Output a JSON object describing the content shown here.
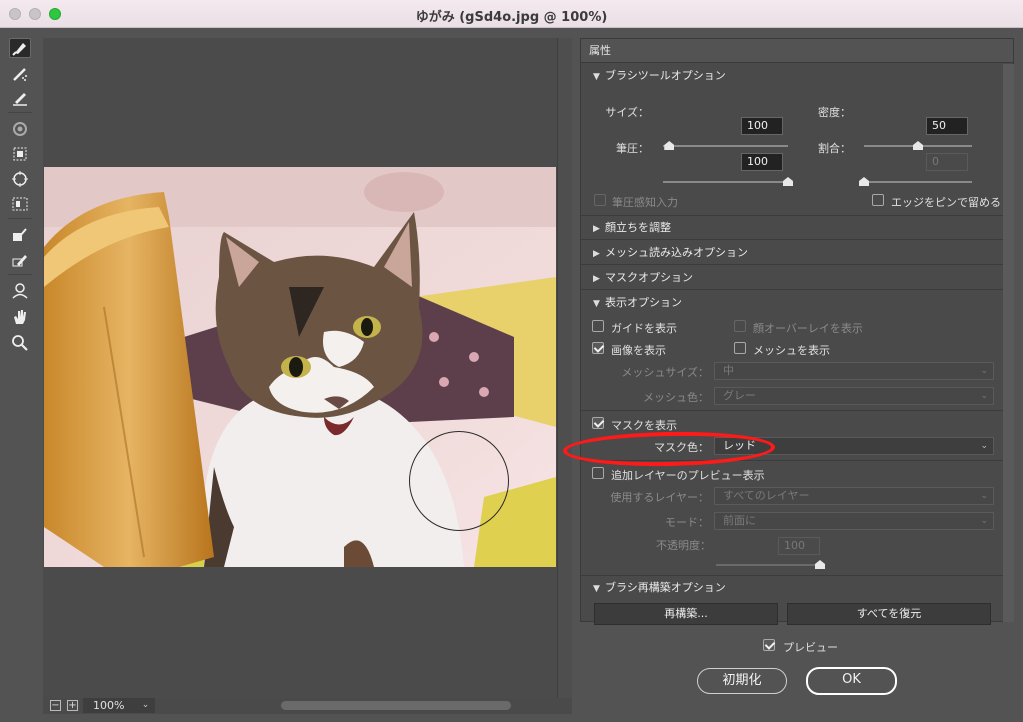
{
  "window": {
    "title": "ゆがみ (gSd4o.jpg @ 100%)"
  },
  "toolbar": {
    "tools": [
      "forward-warp-tool",
      "reconstruct-tool",
      "smooth-tool",
      "twirl-clockwise-tool",
      "pucker-tool",
      "bloat-tool",
      "push-left-tool",
      "freeze-mask-tool",
      "thaw-mask-tool",
      "face-tool",
      "hand-tool",
      "zoom-tool"
    ]
  },
  "canvas": {
    "zoom": "100%",
    "zoom_out": "−",
    "zoom_in": "+"
  },
  "panel": {
    "title": "属性",
    "brush": {
      "header": "ブラシツールオプション",
      "size_label": "サイズ：",
      "size_value": "100",
      "size_fraction": 0.05,
      "density_label": "密度：",
      "density_value": "50",
      "density_fraction": 0.5,
      "pressure_label": "筆圧：",
      "pressure_value": "100",
      "pressure_fraction": 1.0,
      "rate_label": "割合：",
      "rate_value": "0",
      "rate_fraction": 0.0,
      "stylus_label": "筆圧感知入力",
      "pin_edges_label": "エッジをピンで留める"
    },
    "face_header": "顔立ちを調整",
    "mesh_load_header": "メッシュ読み込みオプション",
    "mask_header": "マスクオプション",
    "view": {
      "header": "表示オプション",
      "show_guides": "ガイドを表示",
      "show_face_overlay": "顔オーバーレイを表示",
      "show_image": "画像を表示",
      "show_mesh": "メッシュを表示",
      "mesh_size_label": "メッシュサイズ：",
      "mesh_size_value": "中",
      "mesh_color_label": "メッシュ色：",
      "mesh_color_value": "グレー",
      "show_mask": "マスクを表示",
      "mask_color_label": "マスク色：",
      "mask_color_value": "レッド",
      "show_backdrop": "追加レイヤーのプレビュー表示",
      "use_label": "使用するレイヤー：",
      "use_value": "すべてのレイヤー",
      "mode_label": "モード：",
      "mode_value": "前面に",
      "opacity_label": "不透明度：",
      "opacity_value": "100",
      "opacity_fraction": 1.0
    },
    "reconstruct": {
      "header": "ブラシ再構築オプション",
      "reconstruct_button": "再構築...",
      "restore_all_button": "すべてを復元"
    }
  },
  "footer": {
    "preview_label": "プレビュー",
    "reset_button": "初期化",
    "ok_button": "OK"
  },
  "colors": {
    "highlight": "#ff1a1a",
    "window_bg": "#535353"
  }
}
